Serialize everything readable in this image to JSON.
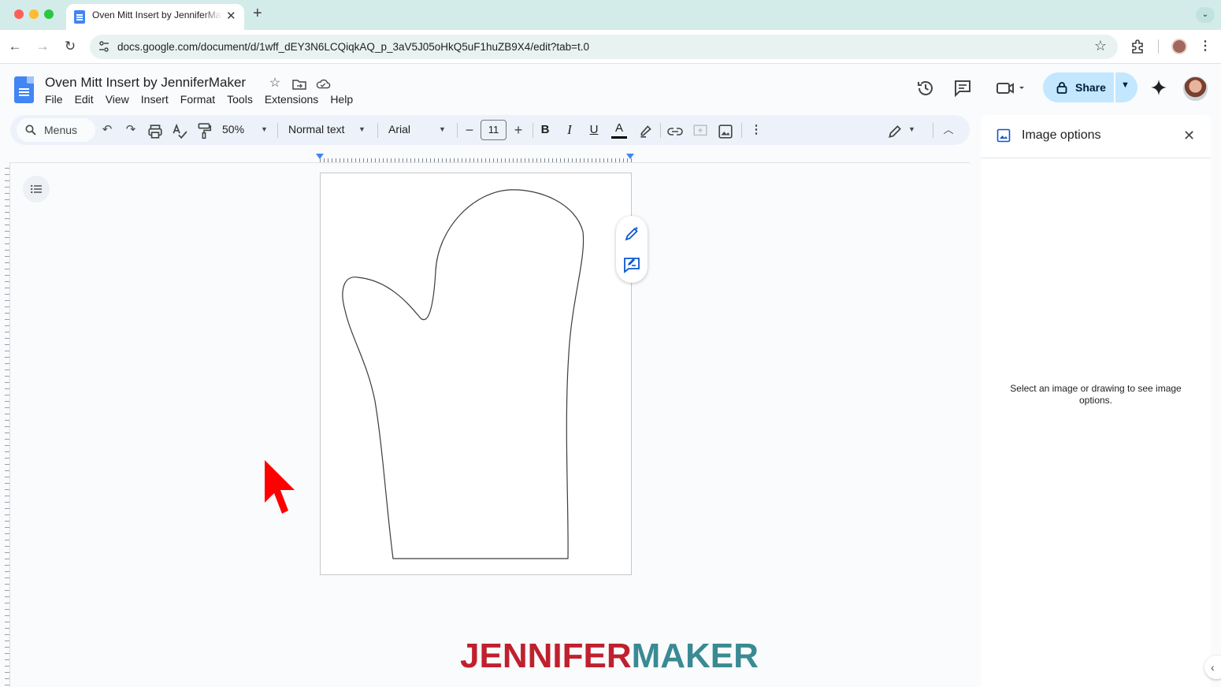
{
  "browser": {
    "tab_title": "Oven Mitt Insert by JenniferMaker",
    "url": "docs.google.com/document/d/1wff_dEY3N6LCQiqkAQ_p_3aV5J05oHkQ5uF1huZB9X4/edit?tab=t.0",
    "icons": [
      "back-icon",
      "forward-icon",
      "reload-icon",
      "site-info-icon",
      "bookmark-star-icon",
      "extensions-icon",
      "profile-avatar",
      "chrome-menu-icon"
    ]
  },
  "doc": {
    "title": "Oven Mitt Insert by JenniferMaker",
    "menus": [
      "File",
      "Edit",
      "View",
      "Insert",
      "Format",
      "Tools",
      "Extensions",
      "Help"
    ],
    "share_label": "Share"
  },
  "toolbar": {
    "search_label": "Menus",
    "zoom": "50%",
    "style": "Normal text",
    "font": "Arial",
    "font_size": "11",
    "bold": "B",
    "italic": "I",
    "underline": "U",
    "text_color": "A"
  },
  "side_panel": {
    "title": "Image options",
    "message": "Select an image or drawing to see image options."
  },
  "watermark": {
    "part1": "JENNIFER",
    "part2": "MAKER"
  },
  "colors": {
    "accent": "#0b57d0",
    "share_bg": "#c2e7ff",
    "cursor": "#ff0000",
    "brand_red": "#c0202e",
    "brand_teal": "#3a8a93"
  }
}
